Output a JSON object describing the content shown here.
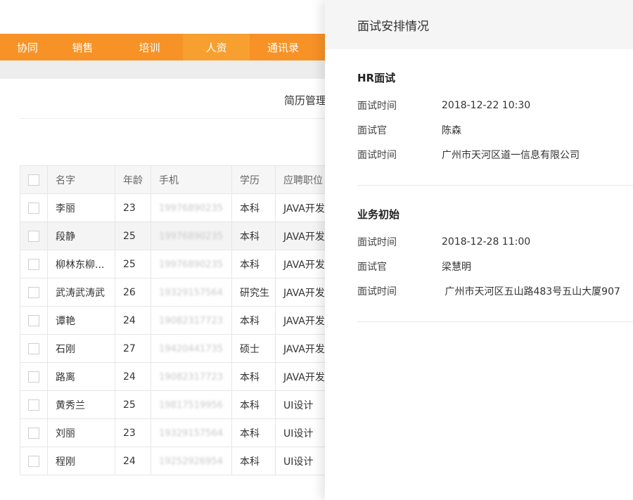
{
  "nav": {
    "items": [
      {
        "label": "协同"
      },
      {
        "label": "销售"
      },
      {
        "label": "培训"
      },
      {
        "label": "人资"
      },
      {
        "label": "通讯录"
      }
    ]
  },
  "page": {
    "section_title": "简历管理"
  },
  "table": {
    "headers": [
      "名字",
      "年龄",
      "手机",
      "学历",
      "应聘职位"
    ],
    "rows": [
      {
        "name": "李丽",
        "age": "23",
        "phone": "19976890235",
        "edu": "本科",
        "job": "JAVA开发"
      },
      {
        "name": "段静",
        "age": "25",
        "phone": "19976890235",
        "edu": "本科",
        "job": "JAVA开发"
      },
      {
        "name": "柳林东柳...",
        "age": "25",
        "phone": "19976890235",
        "edu": "本科",
        "job": "JAVA开发"
      },
      {
        "name": "武涛武涛武",
        "age": "26",
        "phone": "19329157564",
        "edu": "研究生",
        "job": "JAVA开发"
      },
      {
        "name": "谭艳",
        "age": "24",
        "phone": "19082317723",
        "edu": "本科",
        "job": "JAVA开发"
      },
      {
        "name": "石刚",
        "age": "27",
        "phone": "19420441735",
        "edu": "硕士",
        "job": "JAVA开发"
      },
      {
        "name": "路离",
        "age": "24",
        "phone": "19082317723",
        "edu": "本科",
        "job": "JAVA开发"
      },
      {
        "name": "黄秀兰",
        "age": "25",
        "phone": "19817519956",
        "edu": "本科",
        "job": "UI设计"
      },
      {
        "name": "刘丽",
        "age": "23",
        "phone": "19329157564",
        "edu": "本科",
        "job": "UI设计"
      },
      {
        "name": "程刚",
        "age": "24",
        "phone": "19252926954",
        "edu": "本科",
        "job": "UI设计"
      }
    ]
  },
  "drawer": {
    "title": "面试安排情况",
    "sections": [
      {
        "title": "HR面试",
        "rows": [
          {
            "label": "面试时间",
            "value": "2018-12-22 10:30"
          },
          {
            "label": "面试官",
            "value": "陈森"
          },
          {
            "label": "面试时间",
            "value": "广州市天河区道一信息有限公司"
          }
        ]
      },
      {
        "title": "业务初始",
        "rows": [
          {
            "label": "面试时间",
            "value": "2018-12-28 11:00"
          },
          {
            "label": "面试官",
            "value": "梁慧明"
          },
          {
            "label": "面试时间",
            "value": " 广州市天河区五山路483号五山大厦907"
          }
        ]
      }
    ]
  },
  "colors": {
    "nav": "#f79226",
    "nav_active": "#f7a030",
    "header_bg": "#f5f5f5"
  }
}
